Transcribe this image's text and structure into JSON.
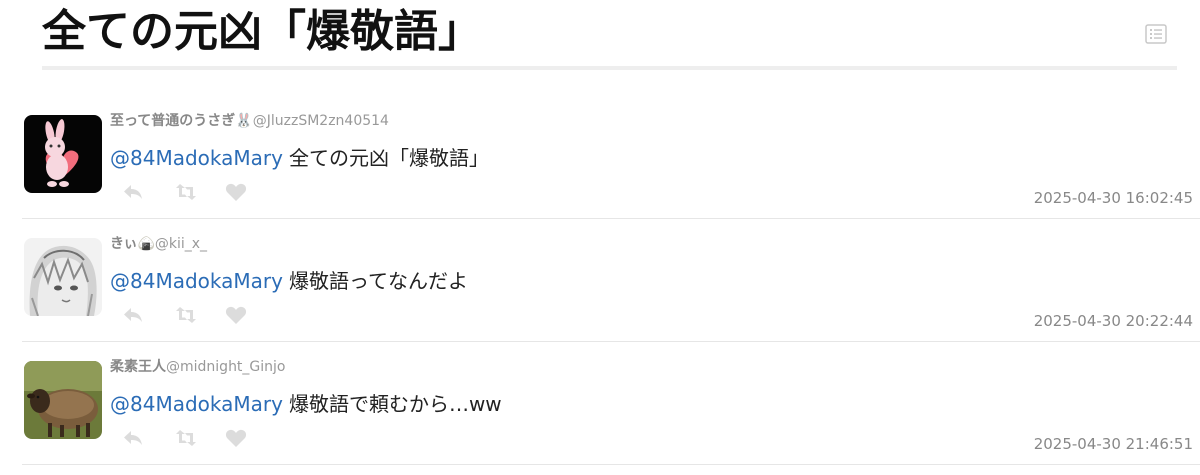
{
  "page": {
    "title": "全ての元凶「爆敬語」"
  },
  "tweets": [
    {
      "name": "至って普通のうさぎ🐰",
      "handle": "@JluzzSM2zn40514",
      "mention": "@84MadokaMary",
      "text": "全ての元凶「爆敬語」",
      "timestamp": "2025-04-30 16:02:45"
    },
    {
      "name": "きぃ🍙",
      "handle": "@kii_x_",
      "mention": "@84MadokaMary",
      "text": "爆敬語ってなんだよ",
      "timestamp": "2025-04-30 20:22:44"
    },
    {
      "name": "柔素王人",
      "handle": "@midnight_Ginjo",
      "mention": "@84MadokaMary",
      "text": "爆敬語で頼むから…ww",
      "timestamp": "2025-04-30 21:46:51"
    }
  ],
  "icons": {
    "header": "list-icon",
    "reply": "reply-icon",
    "retweet": "retweet-icon",
    "like": "heart-icon"
  },
  "colors": {
    "mention": "#2b6cb6",
    "action_icon": "#dcdcdc",
    "meta_text": "#888888",
    "divider": "#e6e6e6"
  }
}
